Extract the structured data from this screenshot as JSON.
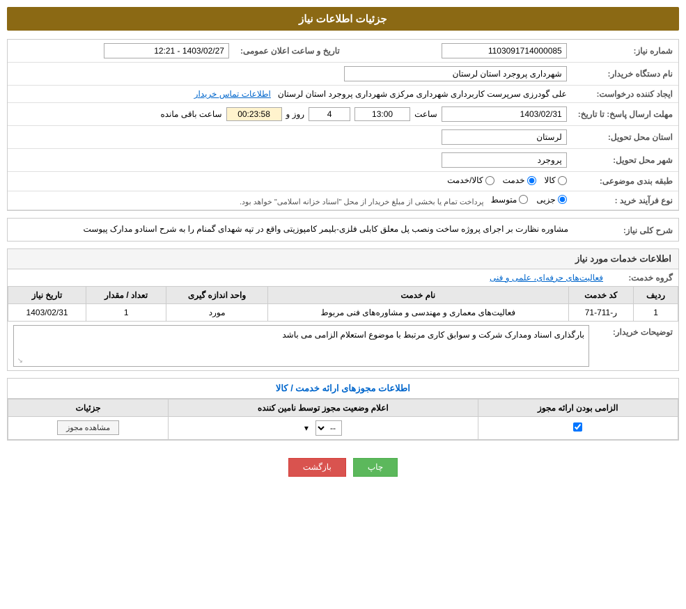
{
  "page": {
    "title": "جزئیات اطلاعات نیاز",
    "header": {
      "bg": "#8B6914"
    }
  },
  "fields": {
    "shomara_niaz_label": "شماره نیاز:",
    "shomara_niaz_value": "1103091714000085",
    "nam_dastgah_label": "نام دستگاه خریدار:",
    "nam_dastgah_value": "شهرداری پروجرد استان لرستان",
    "ijad_label": "ایجاد کننده درخواست:",
    "ijad_value": "علی گودرزی سرپرست کاربرداری شهرداری مرکزی شهرداری پروجرد استان لرستان",
    "ijad_link": "اطلاعات تماس خریدار",
    "mohlat_label": "مهلت ارسال پاسخ: تا تاریخ:",
    "mohlat_date": "1403/02/31",
    "mohlat_saat_label": "ساعت",
    "mohlat_saat": "13:00",
    "mohlat_roz_label": "روز و",
    "mohlat_roz": "4",
    "mohlat_remaining": "00:23:58",
    "mohlat_remaining_label": "ساعت باقی مانده",
    "ostan_label": "استان محل تحویل:",
    "ostan_value": "لرستان",
    "shahr_label": "شهر محل تحویل:",
    "shahr_value": "پروجرد",
    "tarighe_label": "طبقه بندی موضوعی:",
    "radio_kala": "کالا",
    "radio_khedmat": "خدمت",
    "radio_kala_khedmat": "کالا/خدمت",
    "radio_selected": "khedmat",
    "nooe_farayand_label": "نوع فرآیند خرید :",
    "radio_jezyi": "جزیی",
    "radio_mотosat": "متوسط",
    "nooe_farayand_desc": "پرداخت تمام یا بخشی از مبلغ خریدار از محل \"اسناد خزانه اسلامی\" خواهد بود.",
    "tarikh_label": "تاریخ و ساعت اعلان عمومی:",
    "tarikh_value": "1403/02/27 - 12:21",
    "sharh_title": "شرح کلی نیاز:",
    "sharh_text": "مشاوره نظارت بر اجرای پروژه ساخت ونصب پل معلق کابلی فلزی-بلیمر کامپوزیتی  واقع در تپه شهدای گمنام را به شرح اسنادو مدارک پیوست",
    "khadamat_title": "اطلاعات خدمات مورد نیاز",
    "gorooh_label": "گروه خدمت:",
    "gorooh_value": "فعالیت‌های حرفه‌ای، علمی و فنی",
    "table_headers": {
      "radif": "ردیف",
      "kod": "کد خدمت",
      "name": "نام خدمت",
      "unit": "واحد اندازه گیری",
      "count": "تعداد / مقدار",
      "date": "تاریخ نیاز"
    },
    "table_rows": [
      {
        "radif": "1",
        "kod": "ر-711-71",
        "name": "فعالیت‌های معماری و مهندسی و مشاوره‌های فنی مربوط",
        "unit": "مورد",
        "count": "1",
        "date": "1403/02/31"
      }
    ],
    "tosih_label": "توضیحات خریدار:",
    "tosih_value": "بارگذاری اسناد ومدارک شرکت و سوابق کاری مرتبط با موضوع استعلام الزامی می باشد",
    "license_section_title": "اطلاعات مجوزهای ارائه خدمت / کالا",
    "license_table_headers": {
      "elzam": "الزامی بودن ارائه مجوز",
      "elam": "اعلام وضعیت مجوز توسط نامین کننده",
      "joz": "جزئیات"
    },
    "license_row": {
      "elzam_checked": true,
      "elam_value": "--",
      "joz_btn": "مشاهده مجوز"
    },
    "btn_chap": "چاپ",
    "btn_bazgasht": "بازگشت"
  }
}
